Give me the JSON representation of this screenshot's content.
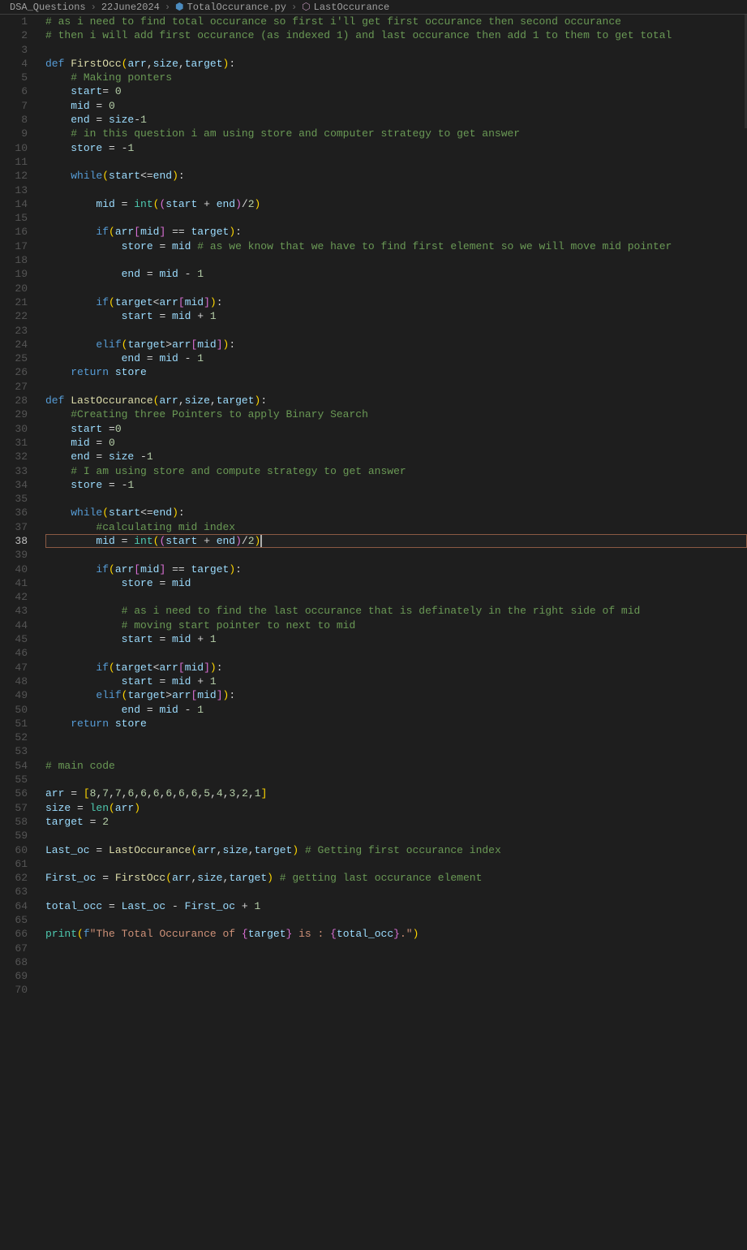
{
  "breadcrumbs": {
    "folder1": "DSA_Questions",
    "folder2": "22June2024",
    "file": "TotalOccurance.py",
    "symbol": "LastOccurance"
  },
  "activeLine": 38,
  "lines": [
    {
      "n": 1,
      "html": "<span class='tok-comment'># as i need to find total occurance so first i'll get first occurance then second occurance</span>"
    },
    {
      "n": 2,
      "html": "<span class='tok-comment'># then i will add first occurance (as indexed 1) and last occurance then add 1 to them to get total</span>"
    },
    {
      "n": 3,
      "html": ""
    },
    {
      "n": 4,
      "html": "<span class='tok-keyword'>def</span> <span class='tok-func'>FirstOcc</span><span class='tok-paren'>(</span><span class='tok-var'>arr</span>,<span class='tok-var'>size</span>,<span class='tok-var'>target</span><span class='tok-paren'>)</span>:"
    },
    {
      "n": 5,
      "html": "    <span class='tok-comment'># Making ponters</span>"
    },
    {
      "n": 6,
      "html": "    <span class='tok-var'>start</span>= <span class='tok-num'>0</span>"
    },
    {
      "n": 7,
      "html": "    <span class='tok-var'>mid</span> = <span class='tok-num'>0</span>"
    },
    {
      "n": 8,
      "html": "    <span class='tok-var'>end</span> = <span class='tok-var'>size</span>-<span class='tok-num'>1</span>"
    },
    {
      "n": 9,
      "html": "    <span class='tok-comment'># in this question i am using store and computer strategy to get answer</span>"
    },
    {
      "n": 10,
      "html": "    <span class='tok-var'>store</span> = -<span class='tok-num'>1</span>"
    },
    {
      "n": 11,
      "html": ""
    },
    {
      "n": 12,
      "html": "    <span class='tok-keyword'>while</span><span class='tok-paren'>(</span><span class='tok-var'>start</span>&lt;=<span class='tok-var'>end</span><span class='tok-paren'>)</span>:"
    },
    {
      "n": 13,
      "html": ""
    },
    {
      "n": 14,
      "html": "        <span class='tok-var'>mid</span> = <span class='tok-builtin'>int</span><span class='tok-paren'>(</span><span class='tok-paren2'>(</span><span class='tok-var'>start</span> + <span class='tok-var'>end</span><span class='tok-paren2'>)</span>/<span class='tok-num'>2</span><span class='tok-paren'>)</span>"
    },
    {
      "n": 15,
      "html": ""
    },
    {
      "n": 16,
      "html": "        <span class='tok-keyword'>if</span><span class='tok-paren'>(</span><span class='tok-var'>arr</span><span class='tok-paren2'>[</span><span class='tok-var'>mid</span><span class='tok-paren2'>]</span> == <span class='tok-var'>target</span><span class='tok-paren'>)</span>:"
    },
    {
      "n": 17,
      "html": "            <span class='tok-var'>store</span> = <span class='tok-var'>mid</span> <span class='tok-comment'># as we know that we have to find first element so we will move mid pointer</span>"
    },
    {
      "n": 18,
      "html": ""
    },
    {
      "n": 19,
      "html": "            <span class='tok-var'>end</span> = <span class='tok-var'>mid</span> - <span class='tok-num'>1</span>"
    },
    {
      "n": 20,
      "html": ""
    },
    {
      "n": 21,
      "html": "        <span class='tok-keyword'>if</span><span class='tok-paren'>(</span><span class='tok-var'>target</span>&lt;<span class='tok-var'>arr</span><span class='tok-paren2'>[</span><span class='tok-var'>mid</span><span class='tok-paren2'>]</span><span class='tok-paren'>)</span>:"
    },
    {
      "n": 22,
      "html": "            <span class='tok-var'>start</span> = <span class='tok-var'>mid</span> + <span class='tok-num'>1</span>"
    },
    {
      "n": 23,
      "html": ""
    },
    {
      "n": 24,
      "html": "        <span class='tok-keyword'>elif</span><span class='tok-paren'>(</span><span class='tok-var'>target</span>&gt;<span class='tok-var'>arr</span><span class='tok-paren2'>[</span><span class='tok-var'>mid</span><span class='tok-paren2'>]</span><span class='tok-paren'>)</span>:"
    },
    {
      "n": 25,
      "html": "            <span class='tok-var'>end</span> = <span class='tok-var'>mid</span> - <span class='tok-num'>1</span>"
    },
    {
      "n": 26,
      "html": "    <span class='tok-keyword'>return</span> <span class='tok-var'>store</span>"
    },
    {
      "n": 27,
      "html": ""
    },
    {
      "n": 28,
      "html": "<span class='tok-keyword'>def</span> <span class='tok-func'>LastOccurance</span><span class='tok-paren'>(</span><span class='tok-var'>arr</span>,<span class='tok-var'>size</span>,<span class='tok-var'>target</span><span class='tok-paren'>)</span>:"
    },
    {
      "n": 29,
      "html": "    <span class='tok-comment'>#Creating three Pointers to apply Binary Search</span>"
    },
    {
      "n": 30,
      "html": "    <span class='tok-var'>start</span> =<span class='tok-num'>0</span>"
    },
    {
      "n": 31,
      "html": "    <span class='tok-var'>mid</span> = <span class='tok-num'>0</span>"
    },
    {
      "n": 32,
      "html": "    <span class='tok-var'>end</span> = <span class='tok-var'>size</span> -<span class='tok-num'>1</span>"
    },
    {
      "n": 33,
      "html": "    <span class='tok-comment'># I am using store and compute strategy to get answer</span>"
    },
    {
      "n": 34,
      "html": "    <span class='tok-var'>store</span> = -<span class='tok-num'>1</span>"
    },
    {
      "n": 35,
      "html": ""
    },
    {
      "n": 36,
      "html": "    <span class='tok-keyword'>while</span><span class='tok-paren'>(</span><span class='tok-var'>start</span>&lt;=<span class='tok-var'>end</span><span class='tok-paren'>)</span>:"
    },
    {
      "n": 37,
      "html": "        <span class='tok-comment'>#calculating mid index</span>"
    },
    {
      "n": 38,
      "html": "        <span class='tok-var'>mid</span> = <span class='tok-builtin'>int</span><span class='tok-paren'>(</span><span class='tok-paren2'>(</span><span class='tok-var'>start</span> + <span class='tok-var'>end</span><span class='tok-paren2'>)</span>/<span class='tok-num'>2</span><span class='tok-paren'>)</span><span class='cursor-box'></span>"
    },
    {
      "n": 39,
      "html": ""
    },
    {
      "n": 40,
      "html": "        <span class='tok-keyword'>if</span><span class='tok-paren'>(</span><span class='tok-var'>arr</span><span class='tok-paren2'>[</span><span class='tok-var'>mid</span><span class='tok-paren2'>]</span> == <span class='tok-var'>target</span><span class='tok-paren'>)</span>:"
    },
    {
      "n": 41,
      "html": "            <span class='tok-var'>store</span> = <span class='tok-var'>mid</span>"
    },
    {
      "n": 42,
      "html": ""
    },
    {
      "n": 43,
      "html": "            <span class='tok-comment'># as i need to find the last occurance that is definately in the right side of mid</span>"
    },
    {
      "n": 44,
      "html": "            <span class='tok-comment'># moving start pointer to next to mid</span>"
    },
    {
      "n": 45,
      "html": "            <span class='tok-var'>start</span> = <span class='tok-var'>mid</span> + <span class='tok-num'>1</span>"
    },
    {
      "n": 46,
      "html": ""
    },
    {
      "n": 47,
      "html": "        <span class='tok-keyword'>if</span><span class='tok-paren'>(</span><span class='tok-var'>target</span>&lt;<span class='tok-var'>arr</span><span class='tok-paren2'>[</span><span class='tok-var'>mid</span><span class='tok-paren2'>]</span><span class='tok-paren'>)</span>:"
    },
    {
      "n": 48,
      "html": "            <span class='tok-var'>start</span> = <span class='tok-var'>mid</span> + <span class='tok-num'>1</span>"
    },
    {
      "n": 49,
      "html": "        <span class='tok-keyword'>elif</span><span class='tok-paren'>(</span><span class='tok-var'>target</span>&gt;<span class='tok-var'>arr</span><span class='tok-paren2'>[</span><span class='tok-var'>mid</span><span class='tok-paren2'>]</span><span class='tok-paren'>)</span>:"
    },
    {
      "n": 50,
      "html": "            <span class='tok-var'>end</span> = <span class='tok-var'>mid</span> - <span class='tok-num'>1</span>"
    },
    {
      "n": 51,
      "html": "    <span class='tok-keyword'>return</span> <span class='tok-var'>store</span>"
    },
    {
      "n": 52,
      "html": ""
    },
    {
      "n": 53,
      "html": ""
    },
    {
      "n": 54,
      "html": "<span class='tok-comment'># main code</span>"
    },
    {
      "n": 55,
      "html": ""
    },
    {
      "n": 56,
      "html": "<span class='tok-var'>arr</span> = <span class='tok-paren'>[</span><span class='tok-num'>8</span>,<span class='tok-num'>7</span>,<span class='tok-num'>7</span>,<span class='tok-num'>6</span>,<span class='tok-num'>6</span>,<span class='tok-num'>6</span>,<span class='tok-num'>6</span>,<span class='tok-num'>6</span>,<span class='tok-num'>6</span>,<span class='tok-num'>5</span>,<span class='tok-num'>4</span>,<span class='tok-num'>3</span>,<span class='tok-num'>2</span>,<span class='tok-num'>1</span><span class='tok-paren'>]</span>"
    },
    {
      "n": 57,
      "html": "<span class='tok-var'>size</span> = <span class='tok-builtin'>len</span><span class='tok-paren'>(</span><span class='tok-var'>arr</span><span class='tok-paren'>)</span>"
    },
    {
      "n": 58,
      "html": "<span class='tok-var'>target</span> = <span class='tok-num'>2</span>"
    },
    {
      "n": 59,
      "html": ""
    },
    {
      "n": 60,
      "html": "<span class='tok-var'>Last_oc</span> = <span class='tok-func'>LastOccurance</span><span class='tok-paren'>(</span><span class='tok-var'>arr</span>,<span class='tok-var'>size</span>,<span class='tok-var'>target</span><span class='tok-paren'>)</span> <span class='tok-comment'># Getting first occurance index</span>"
    },
    {
      "n": 61,
      "html": ""
    },
    {
      "n": 62,
      "html": "<span class='tok-var'>First_oc</span> = <span class='tok-func'>FirstOcc</span><span class='tok-paren'>(</span><span class='tok-var'>arr</span>,<span class='tok-var'>size</span>,<span class='tok-var'>target</span><span class='tok-paren'>)</span> <span class='tok-comment'># getting last occurance element</span>"
    },
    {
      "n": 63,
      "html": ""
    },
    {
      "n": 64,
      "html": "<span class='tok-var'>total_occ</span> = <span class='tok-var'>Last_oc</span> - <span class='tok-var'>First_oc</span> + <span class='tok-num'>1</span>"
    },
    {
      "n": 65,
      "html": ""
    },
    {
      "n": 66,
      "html": "<span class='tok-builtin'>print</span><span class='tok-paren'>(</span><span class='tok-fstring'>f</span><span class='tok-str'>\"The Total Occurance of </span><span class='tok-paren2'>{</span><span class='tok-var'>target</span><span class='tok-paren2'>}</span><span class='tok-str'> is : </span><span class='tok-paren2'>{</span><span class='tok-var'>total_occ</span><span class='tok-paren2'>}</span><span class='tok-str'>.\"</span><span class='tok-paren'>)</span>"
    },
    {
      "n": 67,
      "html": ""
    },
    {
      "n": 68,
      "html": ""
    },
    {
      "n": 69,
      "html": ""
    },
    {
      "n": 70,
      "html": ""
    }
  ]
}
